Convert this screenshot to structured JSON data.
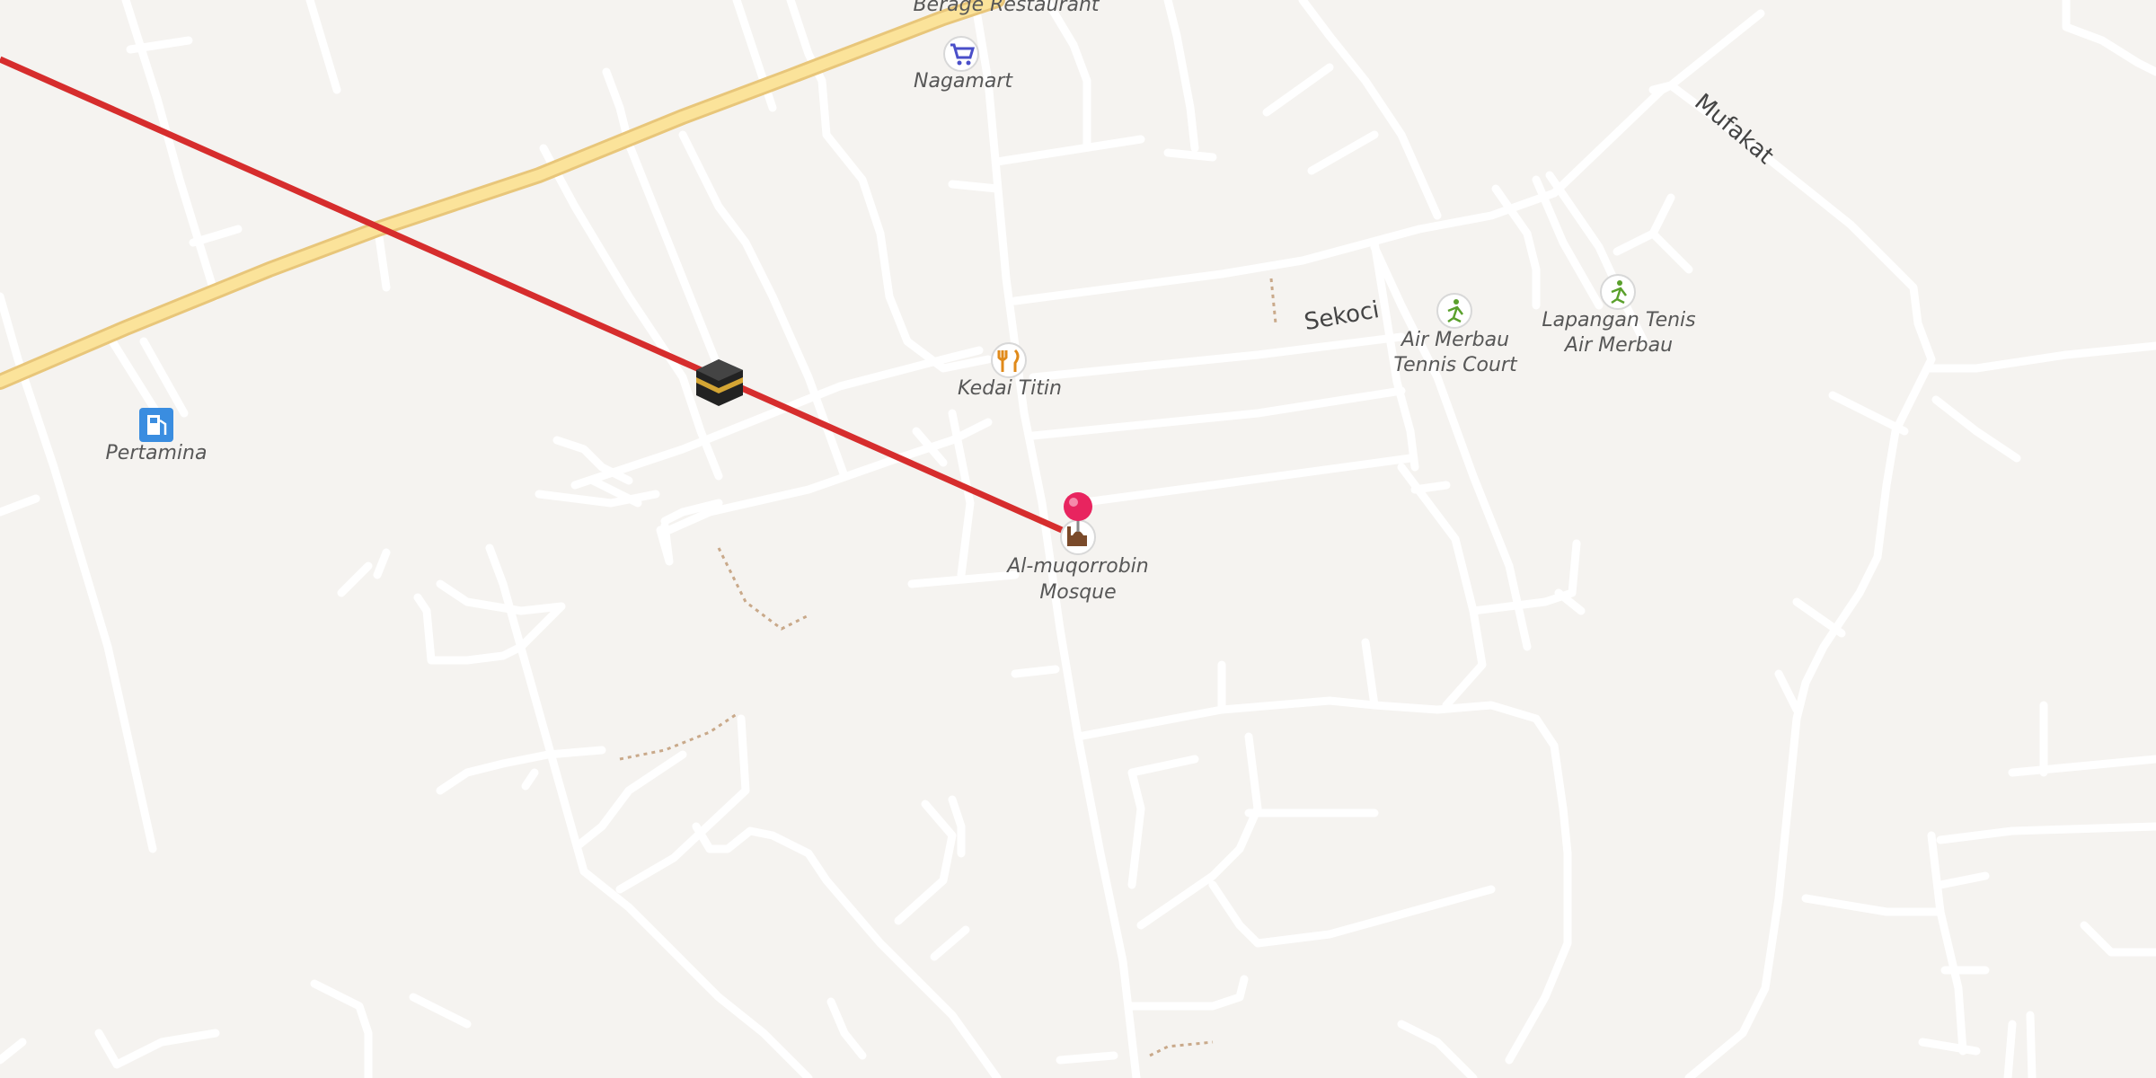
{
  "map": {
    "poi": {
      "restaurant_top": "Berage Restaurant",
      "nagamart": "Nagamart",
      "kedai_titin": "Kedai Titin",
      "pertamina": "Pertamina",
      "mosque_line1": "Al-muqorrobin",
      "mosque_line2": "Mosque",
      "tennis1_line1": "Air Merbau",
      "tennis1_line2": "Tennis Court",
      "tennis2_line1": "Lapangan Tenis",
      "tennis2_line2": "Air Merbau"
    },
    "streets": {
      "sekoci": "Sekoci",
      "mufakat": "Mufakat"
    },
    "icons": {
      "shop": "shopping-cart-icon",
      "restaurant": "fork-knife-icon",
      "fuel": "fuel-pump-icon",
      "mosque": "mosque-icon",
      "tennis": "tennis-icon",
      "pin": "location-pin-icon",
      "kaaba": "kaaba-icon"
    },
    "colors": {
      "background": "#f5f3f0",
      "road": "#ffffff",
      "main_road": "#fbe39a",
      "qibla_line": "#d62d2d",
      "pin": "#e8245f",
      "shop_icon": "#4a4fc9",
      "fuel_icon": "#3a8de0",
      "tennis_icon": "#5aa02c"
    }
  }
}
